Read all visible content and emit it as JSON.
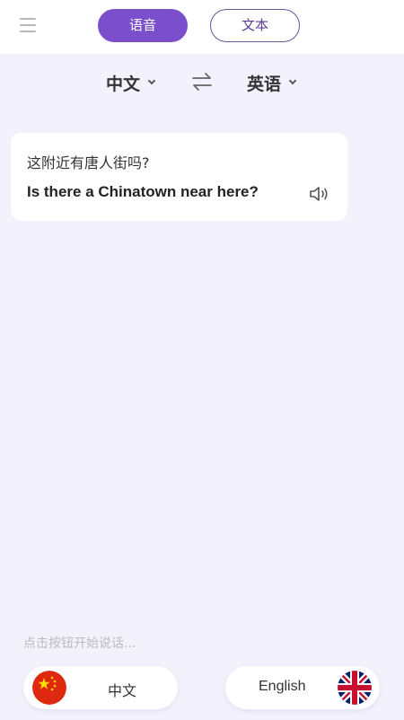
{
  "header": {
    "tabs": [
      {
        "label": "语音",
        "active": true
      },
      {
        "label": "文本",
        "active": false
      }
    ]
  },
  "languages": {
    "source": "中文",
    "target": "英语"
  },
  "conversation": {
    "source_text": "这附近有唐人街吗?",
    "translated_text": "Is there a Chinatown near here?"
  },
  "hint": "点击按钮开始说话...",
  "speak_buttons": {
    "chinese_label": "中文",
    "english_label": "English"
  },
  "colors": {
    "accent": "#7b4fcb",
    "background": "#f3f1fb"
  }
}
